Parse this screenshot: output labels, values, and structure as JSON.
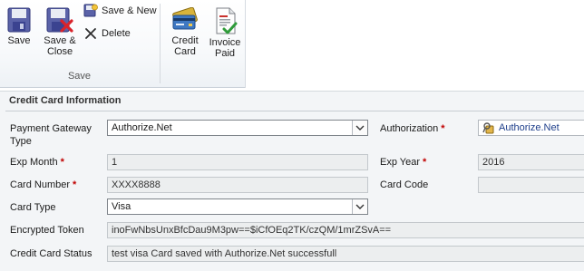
{
  "ribbon": {
    "save": "Save",
    "save_close_1": "Save &",
    "save_close_2": "Close",
    "save_new": "Save & New",
    "delete": "Delete",
    "credit_card_1": "Credit",
    "credit_card_2": "Card",
    "invoice_paid_1": "Invoice",
    "invoice_paid_2": "Paid",
    "group_save": "Save"
  },
  "section": {
    "title": "Credit Card Information"
  },
  "fields": {
    "payment_gateway_type": {
      "label_1": "Payment Gateway",
      "label_2": "Type",
      "value": "Authorize.Net"
    },
    "authorization": {
      "label": "Authorization",
      "value": "Authorize.Net"
    },
    "exp_month": {
      "label": "Exp Month",
      "value": "1"
    },
    "exp_year": {
      "label": "Exp Year",
      "value": "2016"
    },
    "card_number": {
      "label": "Card Number",
      "value": "XXXX8888"
    },
    "card_code": {
      "label": "Card Code",
      "value": ""
    },
    "card_type": {
      "label": "Card Type",
      "value": "Visa"
    },
    "encrypted_token": {
      "label": "Encrypted Token",
      "value": "inoFwNbsUnxBfcDau9M3pw==$iCfOEq2TK/czQM/1mrZSvA=="
    },
    "credit_card_status": {
      "label": "Credit Card Status",
      "value": "test visa Card saved with Authorize.Net successfull"
    }
  },
  "colors": {
    "required": "#c00000",
    "lookup_link": "#1d3e8a"
  },
  "icons": [
    "save-icon",
    "save-close-icon",
    "save-new-icon",
    "delete-icon",
    "credit-card-icon",
    "invoice-paid-icon",
    "lookup-record-icon",
    "dropdown-arrow-icon"
  ]
}
